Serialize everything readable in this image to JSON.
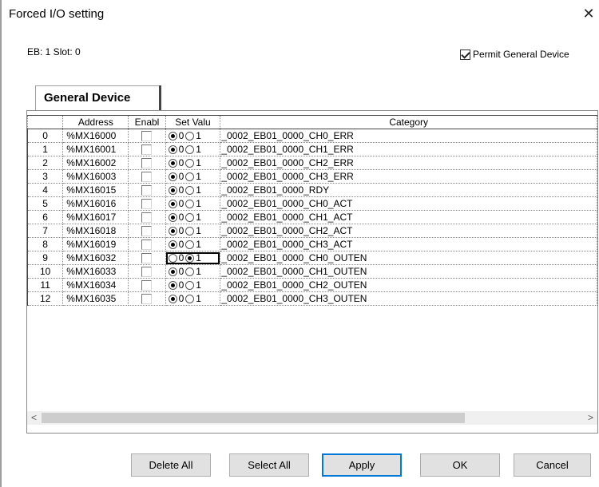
{
  "window": {
    "title": "Forced I/O setting",
    "close": "✕"
  },
  "info": {
    "eb_slot": "EB: 1 Slot: 0"
  },
  "permit": {
    "label": "Permit General Device",
    "checked": true
  },
  "tab": {
    "label": "General Device"
  },
  "grid": {
    "headers": {
      "address": "Address",
      "enable": "Enabl",
      "set": "Set Valu",
      "category": "Category"
    },
    "radio_labels": [
      "0",
      "1"
    ],
    "rows": [
      {
        "idx": "0",
        "address": "%MX16000",
        "enabled": false,
        "value": 0,
        "category": "_0002_EB01_0000_CH0_ERR"
      },
      {
        "idx": "1",
        "address": "%MX16001",
        "enabled": false,
        "value": 0,
        "category": "_0002_EB01_0000_CH1_ERR"
      },
      {
        "idx": "2",
        "address": "%MX16002",
        "enabled": false,
        "value": 0,
        "category": "_0002_EB01_0000_CH2_ERR"
      },
      {
        "idx": "3",
        "address": "%MX16003",
        "enabled": false,
        "value": 0,
        "category": "_0002_EB01_0000_CH3_ERR"
      },
      {
        "idx": "4",
        "address": "%MX16015",
        "enabled": false,
        "value": 0,
        "category": "_0002_EB01_0000_RDY"
      },
      {
        "idx": "5",
        "address": "%MX16016",
        "enabled": false,
        "value": 0,
        "category": "_0002_EB01_0000_CH0_ACT"
      },
      {
        "idx": "6",
        "address": "%MX16017",
        "enabled": false,
        "value": 0,
        "category": "_0002_EB01_0000_CH1_ACT"
      },
      {
        "idx": "7",
        "address": "%MX16018",
        "enabled": false,
        "value": 0,
        "category": "_0002_EB01_0000_CH2_ACT"
      },
      {
        "idx": "8",
        "address": "%MX16019",
        "enabled": false,
        "value": 0,
        "category": "_0002_EB01_0000_CH3_ACT"
      },
      {
        "idx": "9",
        "address": "%MX16032",
        "enabled": false,
        "value": 1,
        "focused": true,
        "category": "_0002_EB01_0000_CH0_OUTEN"
      },
      {
        "idx": "10",
        "address": "%MX16033",
        "enabled": false,
        "value": 0,
        "category": "_0002_EB01_0000_CH1_OUTEN"
      },
      {
        "idx": "11",
        "address": "%MX16034",
        "enabled": false,
        "value": 0,
        "category": "_0002_EB01_0000_CH2_OUTEN"
      },
      {
        "idx": "12",
        "address": "%MX16035",
        "enabled": false,
        "value": 0,
        "category": "_0002_EB01_0000_CH3_OUTEN"
      }
    ]
  },
  "scrollbar": {
    "left": "<",
    "right": ">"
  },
  "buttons": {
    "delete_all": "Delete All",
    "select_all": "Select All",
    "apply": "Apply",
    "ok": "OK",
    "cancel": "Cancel"
  }
}
